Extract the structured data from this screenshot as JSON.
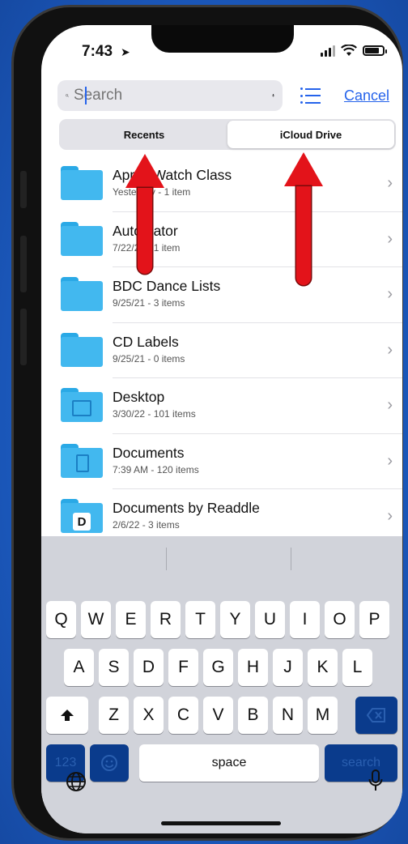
{
  "status": {
    "time": "7:43",
    "location_icon": "location-arrow-icon",
    "signal_icon": "signal-icon",
    "wifi_icon": "wifi-icon",
    "battery_icon": "battery-icon"
  },
  "search": {
    "placeholder": "Search",
    "mic_icon": "microphone-icon",
    "list_icon": "list-view-icon",
    "cancel_label": "Cancel"
  },
  "segments": [
    {
      "label": "Recents",
      "active": false
    },
    {
      "label": "iCloud Drive",
      "active": true
    }
  ],
  "files": [
    {
      "name": "Apple Watch Class",
      "meta": "Yesterday - 1 item",
      "icon": "folder"
    },
    {
      "name": "Automator",
      "meta": "7/22/21 - 1 item",
      "icon": "folder"
    },
    {
      "name": "BDC Dance Lists",
      "meta": "9/25/21 - 3 items",
      "icon": "folder"
    },
    {
      "name": "CD Labels",
      "meta": "9/25/21 - 0 items",
      "icon": "folder"
    },
    {
      "name": "Desktop",
      "meta": "3/30/22 - 101 items",
      "icon": "desktop-folder"
    },
    {
      "name": "Documents",
      "meta": "7:39 AM - 120 items",
      "icon": "documents-folder"
    },
    {
      "name": "Documents by Readdle",
      "meta": "2/6/22 - 3 items",
      "icon": "readdle-folder"
    }
  ],
  "keyboard": {
    "row1": [
      "Q",
      "W",
      "E",
      "R",
      "T",
      "Y",
      "U",
      "I",
      "O",
      "P"
    ],
    "row2": [
      "A",
      "S",
      "D",
      "F",
      "G",
      "H",
      "J",
      "K",
      "L"
    ],
    "row3": [
      "Z",
      "X",
      "C",
      "V",
      "B",
      "N",
      "M"
    ],
    "numbers_label": "123",
    "space_label": "space",
    "search_label": "search"
  },
  "colors": {
    "accent": "#2563eb",
    "folder": "#42b8ef",
    "annotation_arrow": "#e3131a",
    "background": "#1e63c9"
  }
}
